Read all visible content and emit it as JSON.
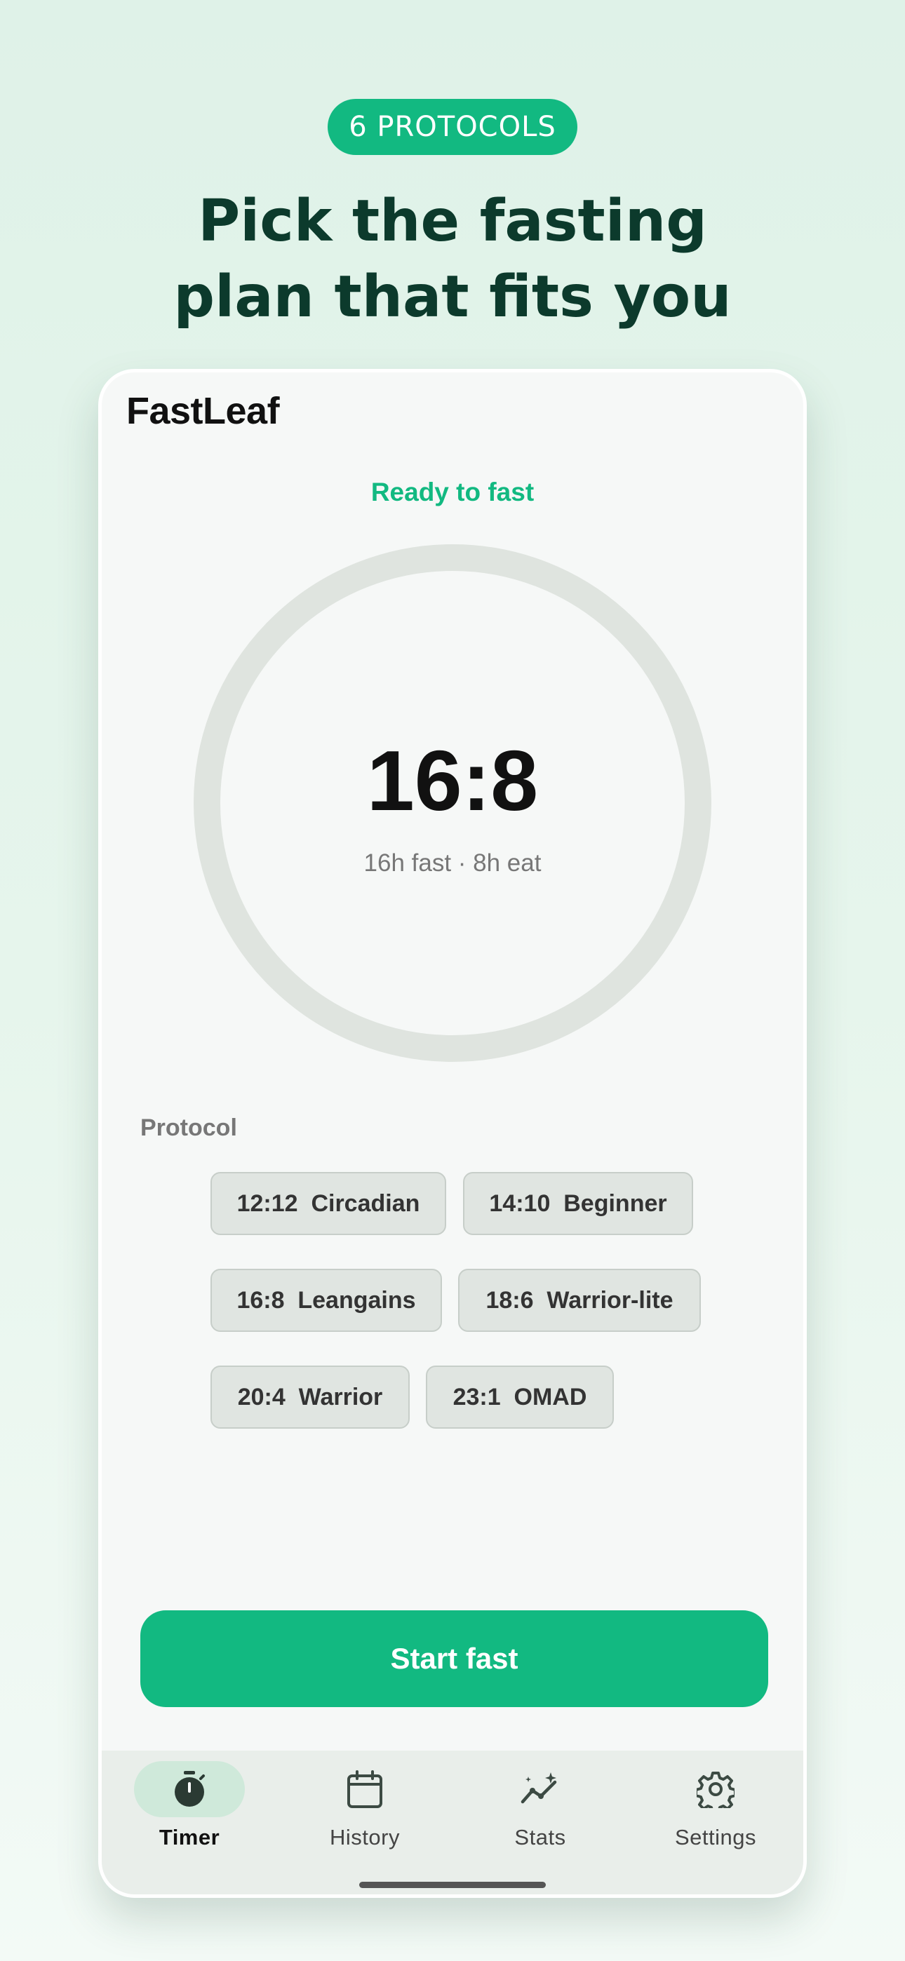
{
  "promo": {
    "badge": "6 PROTOCOLS",
    "headline_line1": "Pick the fasting",
    "headline_line2": "plan that fits you"
  },
  "app": {
    "name": "FastLeaf",
    "status": "Ready to fast",
    "timer": {
      "value": "16:8",
      "subtitle": "16h fast · 8h eat",
      "progress": 0
    },
    "protocol_label": "Protocol",
    "protocols": [
      {
        "label": "12:12  Circadian",
        "selected": false
      },
      {
        "label": "14:10  Beginner",
        "selected": false
      },
      {
        "label": "16:8  Leangains",
        "selected": true
      },
      {
        "label": "18:6  Warrior-lite",
        "selected": false
      },
      {
        "label": "20:4  Warrior",
        "selected": false
      },
      {
        "label": "23:1  OMAD",
        "selected": false
      }
    ],
    "start_button": "Start fast",
    "nav": [
      {
        "label": "Timer",
        "icon": "stopwatch-icon",
        "active": true
      },
      {
        "label": "History",
        "icon": "calendar-icon",
        "active": false
      },
      {
        "label": "Stats",
        "icon": "trend-chart-icon",
        "active": false
      },
      {
        "label": "Settings",
        "icon": "gear-icon",
        "active": false
      }
    ]
  },
  "colors": {
    "accent": "#12b981",
    "headline": "#0c3a2c",
    "ring_track": "#dfe4df",
    "chip_bg": "#e0e5e1"
  }
}
